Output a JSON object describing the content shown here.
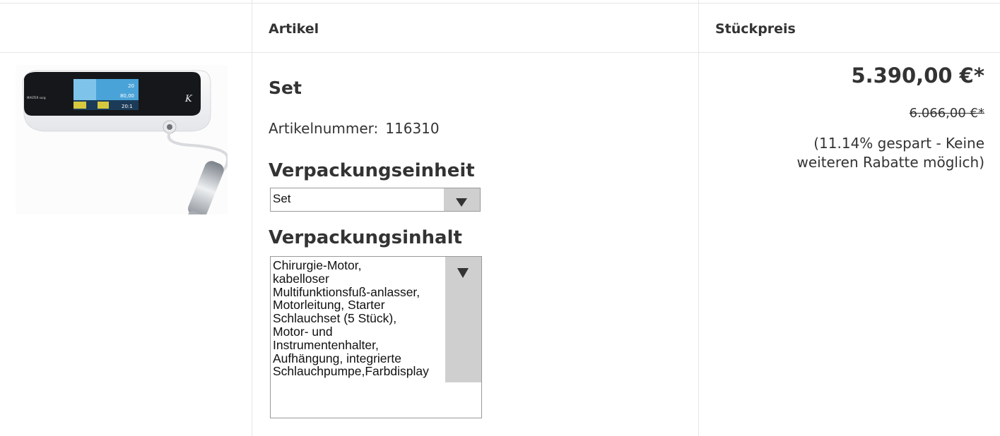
{
  "header": {
    "article_label": "Artikel",
    "unit_price_label": "Stückpreis"
  },
  "product": {
    "name": "Set",
    "article_number_label": "Artikelnummer:",
    "article_number": "116310",
    "image_icon": "dental-surgery-motor-unit-image",
    "device_screen": {
      "top": "20",
      "mid": "80,00",
      "ratio": "20:1",
      "logo": "MASTER surg"
    }
  },
  "packaging_unit": {
    "title": "Verpackungseinheit",
    "selected": "Set"
  },
  "packaging_content": {
    "title": "Verpackungsinhalt",
    "lines": [
      "Chirurgie-Motor,",
      "kabelloser",
      "Multifunktionsfuß-anlasser,",
      "Motorleitung, Starter",
      "Schlauchset (5 Stück),",
      "Motor- und",
      "Instrumentenhalter,",
      "Aufhängung, integrierte",
      "Schlauchpumpe,Farbdisplay"
    ]
  },
  "pricing": {
    "price": "5.390,00 €*",
    "old_price": "6.066,00 €*",
    "saving_note": "(11.14% gespart - Keine weiteren Rabatte möglich)"
  },
  "colors": {
    "text": "#333333",
    "border": "#e6e6e6",
    "select_arrow_bg": "#cfcfcf"
  }
}
